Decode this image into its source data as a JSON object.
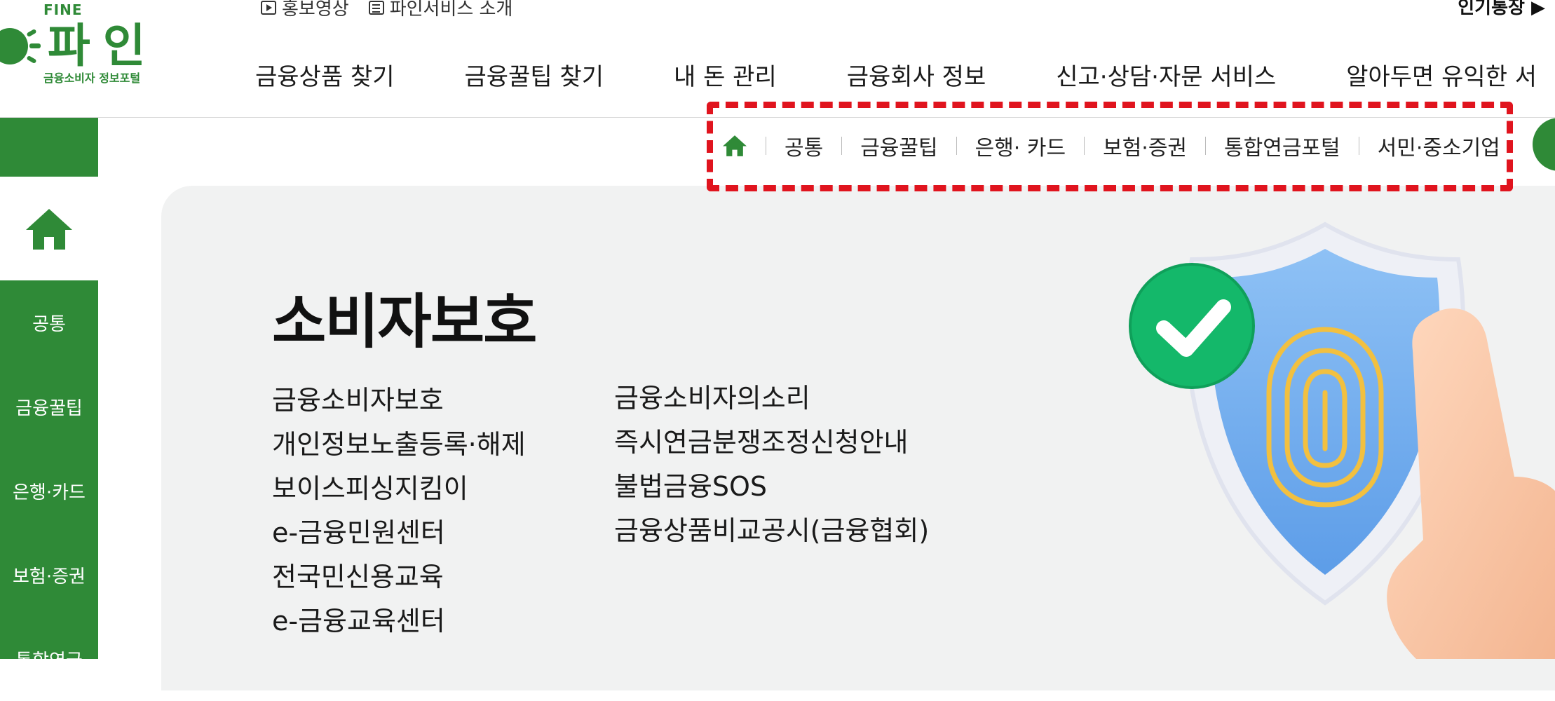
{
  "header": {
    "logo": {
      "brand_en": "FINE",
      "brand_ko": "파인",
      "tagline": "금융소비자 정보포털"
    },
    "util_links": [
      {
        "label": "홍보영상",
        "icon": "play-video-icon"
      },
      {
        "label": "파인서비스 소개",
        "icon": "document-list-icon"
      }
    ],
    "popular_label": "인기통장 ▶",
    "gnb": [
      {
        "label": "금융상품 찾기"
      },
      {
        "label": "금융꿀팁 찾기"
      },
      {
        "label": "내 돈 관리"
      },
      {
        "label": "금융회사 정보"
      },
      {
        "label": "신고·상담·자문 서비스"
      },
      {
        "label": "알아두면 유익한 서"
      }
    ]
  },
  "sidebar": {
    "home_icon": "home-icon",
    "items": [
      {
        "label": "공통"
      },
      {
        "label": "금융꿀팁"
      },
      {
        "label": "은행·카드"
      },
      {
        "label": "보험·증권"
      },
      {
        "label": "통합연금"
      }
    ]
  },
  "subnav": {
    "home_icon": "home-icon",
    "items": [
      {
        "label": "공통"
      },
      {
        "label": "금융꿀팁"
      },
      {
        "label": "은행· 카드"
      },
      {
        "label": "보험·증권"
      },
      {
        "label": "통합연금포털"
      },
      {
        "label": "서민·중소기업"
      }
    ]
  },
  "main": {
    "title": "소비자보호",
    "links_left": [
      {
        "label": "금융소비자보호"
      },
      {
        "label": "개인정보노출등록·해제"
      },
      {
        "label": "보이스피싱지킴이"
      },
      {
        "label": "e-금융민원센터"
      },
      {
        "label": "전국민신용교육"
      },
      {
        "label": "e-금융교육센터"
      }
    ],
    "links_right": [
      {
        "label": "금융소비자의소리"
      },
      {
        "label": "즉시연금분쟁조정신청안내"
      },
      {
        "label": "불법금융SOS"
      },
      {
        "label": "금융상품비교공시(금융협회)"
      }
    ],
    "illustration": "shield-fingerprint-check-illustration"
  },
  "colors": {
    "brand_green": "#2f8a37",
    "panel_bg": "#f1f2f2",
    "highlight_red": "#e0141e"
  }
}
